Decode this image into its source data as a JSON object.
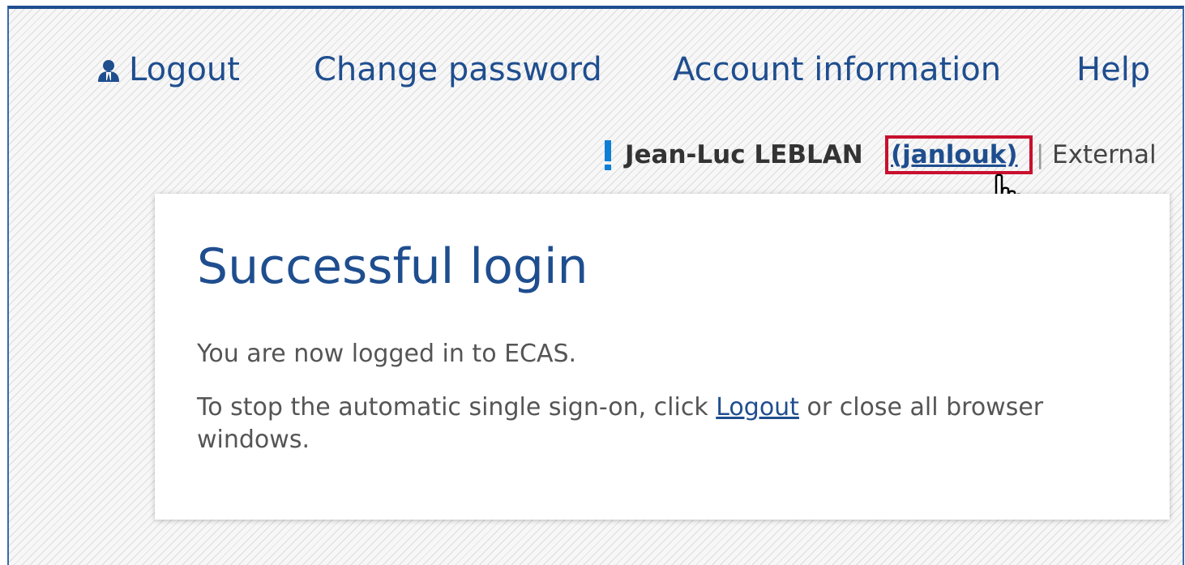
{
  "nav": {
    "logout": "Logout",
    "change_password": "Change password",
    "account_information": "Account information",
    "help": "Help"
  },
  "user": {
    "name": "Jean-Luc LEBLAN",
    "id": "(janlouk)",
    "separator": "|",
    "type": "External"
  },
  "card": {
    "title": "Successful login",
    "line1": "You are now logged in to ECAS.",
    "line2_before": "To stop the automatic single sign-on, click ",
    "line2_link": "Logout",
    "line2_after": " or close all browser windows."
  },
  "colors": {
    "brand_blue": "#1f4e8f",
    "highlight_red": "#c8102e",
    "text_gray": "#555555"
  },
  "icons": [
    "user-icon",
    "exclamation-icon",
    "hand-pointer-icon"
  ]
}
